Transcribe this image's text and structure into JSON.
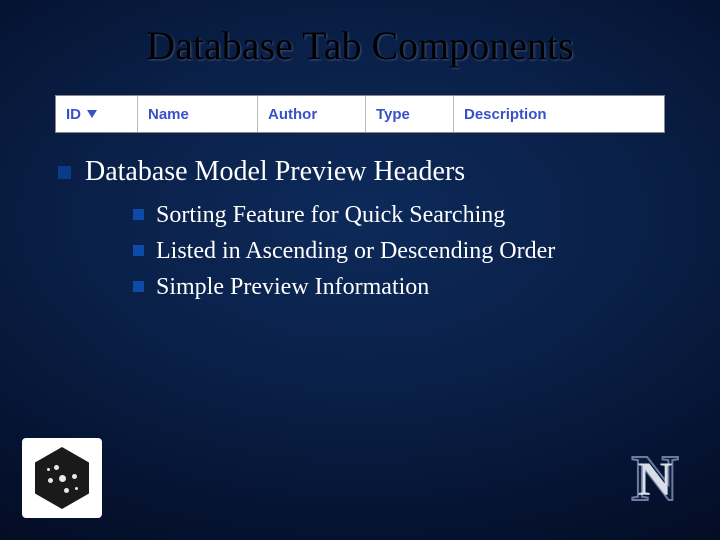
{
  "title": "Database Tab Components",
  "headers": {
    "id": {
      "label": "ID",
      "sorted": true
    },
    "name": {
      "label": "Name"
    },
    "author": {
      "label": "Author"
    },
    "type": {
      "label": "Type"
    },
    "description": {
      "label": "Description"
    }
  },
  "main_bullet": "Database Model Preview Headers",
  "sub_bullets": [
    "Sorting Feature for Quick Searching",
    "Listed in Ascending or Descending Order",
    "Simple Preview Information"
  ],
  "logos": {
    "left_alt": "neuron-hex-logo",
    "right_letter": "N"
  }
}
